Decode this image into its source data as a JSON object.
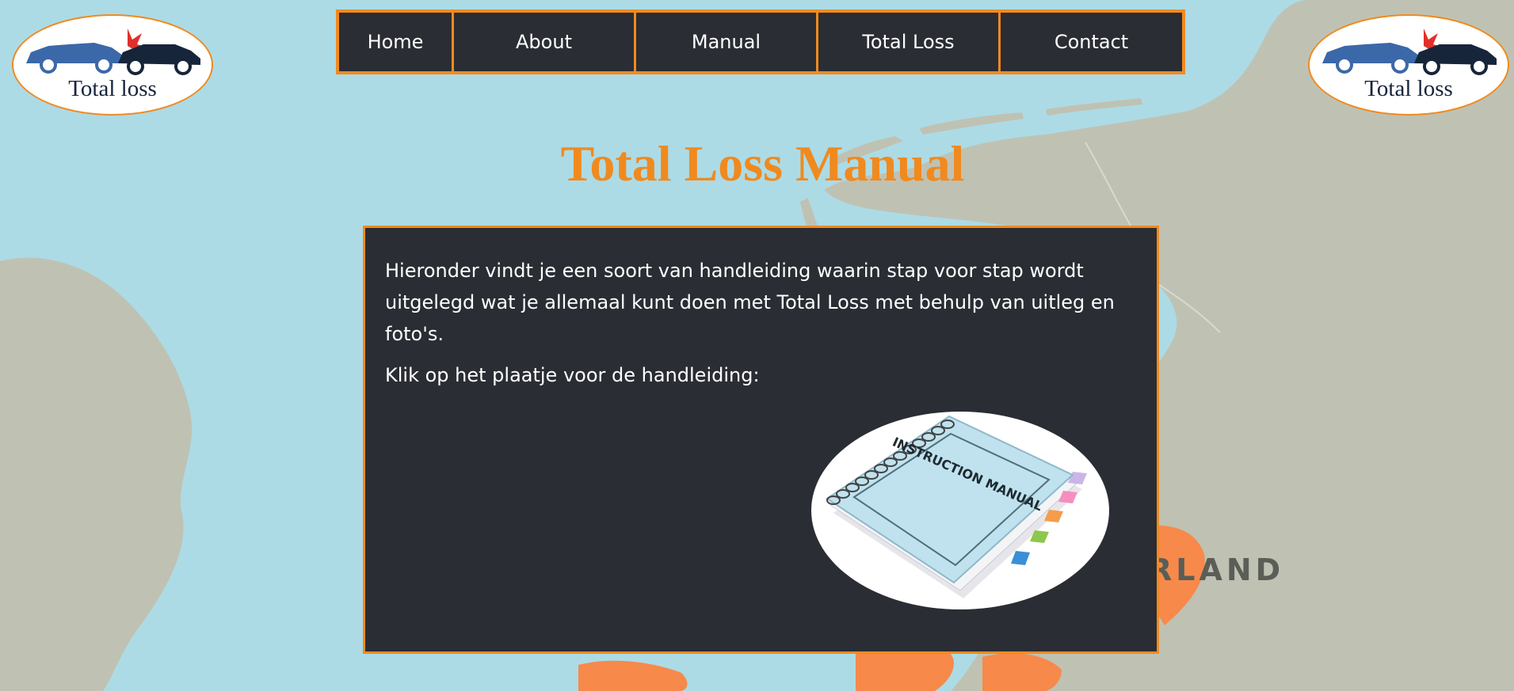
{
  "logo": {
    "text": "Total loss"
  },
  "nav": [
    {
      "label": "Home"
    },
    {
      "label": "About"
    },
    {
      "label": "Manual"
    },
    {
      "label": "Total Loss"
    },
    {
      "label": "Contact"
    }
  ],
  "page": {
    "title": "Total Loss Manual"
  },
  "content": {
    "intro": "Hieronder vindt je een soort van handleiding waarin stap voor stap wordt uitgelegd wat je allemaal kunt doen met Total Loss met behulp van uitleg en foto's.",
    "click_hint": "Klik op het plaatje voor de handleiding:",
    "manual_cover_text": "INSTRUCTION MANUAL"
  },
  "map": {
    "label": "RLAND"
  },
  "colors": {
    "accent": "#f08a1f",
    "panel": "#2a2d33",
    "sea": "#acdbe6",
    "land": "#bfc2b3",
    "highlight": "#f7894a"
  }
}
